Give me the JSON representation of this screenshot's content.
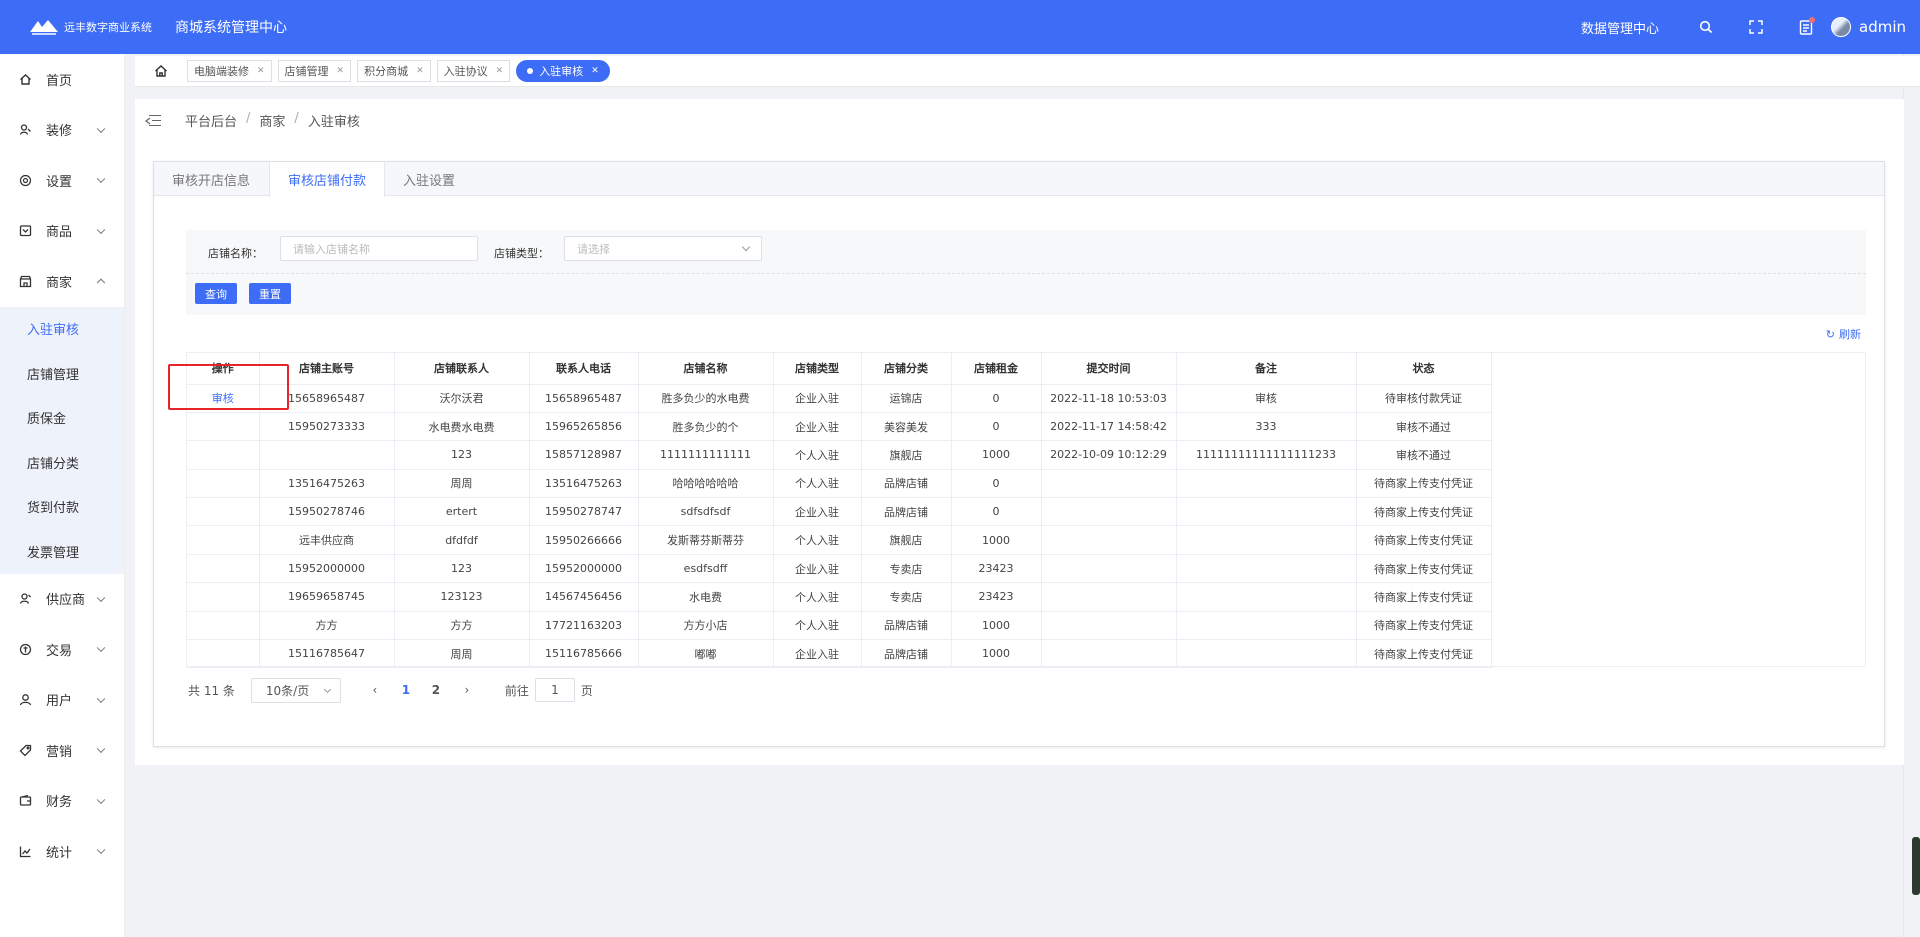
{
  "header": {
    "logo_text": "远丰数字商业系统",
    "system_title": "商城系统管理中心",
    "data_center": "数据管理中心",
    "username": "admin"
  },
  "sidebar": {
    "items": [
      {
        "label": "首页",
        "icon": "home-icon"
      },
      {
        "label": "装修",
        "icon": "brush-icon"
      },
      {
        "label": "设置",
        "icon": "gear-icon"
      },
      {
        "label": "商品",
        "icon": "goods-icon"
      },
      {
        "label": "商家",
        "icon": "store-icon"
      }
    ],
    "submenu": [
      "入驻审核",
      "店铺管理",
      "质保金",
      "店铺分类",
      "货到付款",
      "发票管理"
    ],
    "items_after": [
      {
        "label": "供应商",
        "icon": "supplier-icon"
      },
      {
        "label": "交易",
        "icon": "trade-icon"
      },
      {
        "label": "用户",
        "icon": "user-icon"
      },
      {
        "label": "营销",
        "icon": "tag-icon"
      },
      {
        "label": "财务",
        "icon": "wallet-icon"
      },
      {
        "label": "统计",
        "icon": "chart-icon"
      }
    ]
  },
  "page_tabs": [
    "电脑端装修",
    "店铺管理",
    "积分商城",
    "入驻协议",
    "入驻审核"
  ],
  "breadcrumb": [
    "平台后台",
    "商家",
    "入驻审核"
  ],
  "card_tabs": [
    "审核开店信息",
    "审核店铺付款",
    "入驻设置"
  ],
  "filter": {
    "shop_name_label": "店铺名称：",
    "shop_name_placeholder": "请输入店铺名称",
    "shop_type_label": "店铺类型：",
    "shop_type_placeholder": "请选择",
    "query_button": "查询",
    "reset_button": "重置"
  },
  "refresh_label": "刷新",
  "table": {
    "columns": [
      "操作",
      "店铺主账号",
      "店铺联系人",
      "联系人电话",
      "店铺名称",
      "店铺类型",
      "店铺分类",
      "店铺租金",
      "提交时间",
      "备注",
      "状态"
    ],
    "rows": [
      [
        "审核",
        "15658965487",
        "沃尔沃君",
        "15658965487",
        "胜多负少的水电费",
        "企业入驻",
        "运锦店",
        "0",
        "2022-11-18 10:53:03",
        "审核",
        "待审核付款凭证"
      ],
      [
        "",
        "15950273333",
        "水电费水电费",
        "15965265856",
        "胜多负少的个",
        "企业入驻",
        "美容美发",
        "0",
        "2022-11-17 14:58:42",
        "333",
        "审核不通过"
      ],
      [
        "",
        "",
        "123",
        "15857128987",
        "1111111111111",
        "个人入驻",
        "旗舰店",
        "1000",
        "2022-10-09 10:12:29",
        "11111111111111111233",
        "审核不通过"
      ],
      [
        "",
        "13516475263",
        "周周",
        "13516475263",
        "哈哈哈哈哈哈",
        "个人入驻",
        "品牌店铺",
        "0",
        "",
        "",
        "待商家上传支付凭证"
      ],
      [
        "",
        "15950278746",
        "ertert",
        "15950278747",
        "sdfsdfsdf",
        "企业入驻",
        "品牌店铺",
        "0",
        "",
        "",
        "待商家上传支付凭证"
      ],
      [
        "",
        "远丰供应商",
        "dfdfdf",
        "15950266666",
        "发斯蒂芬斯蒂芬",
        "个人入驻",
        "旗舰店",
        "1000",
        "",
        "",
        "待商家上传支付凭证"
      ],
      [
        "",
        "15952000000",
        "123",
        "15952000000",
        "esdfsdff",
        "企业入驻",
        "专卖店",
        "23423",
        "",
        "",
        "待商家上传支付凭证"
      ],
      [
        "",
        "19659658745",
        "123123",
        "14567456456",
        "水电费",
        "个人入驻",
        "专卖店",
        "23423",
        "",
        "",
        "待商家上传支付凭证"
      ],
      [
        "",
        "方方",
        "方方",
        "17721163203",
        "方方小店",
        "个人入驻",
        "品牌店铺",
        "1000",
        "",
        "",
        "待商家上传支付凭证"
      ],
      [
        "",
        "15116785647",
        "周周",
        "15116785666",
        "嘟嘟",
        "企业入驻",
        "品牌店铺",
        "1000",
        "",
        "",
        "待商家上传支付凭证"
      ]
    ]
  },
  "pagination": {
    "total": "共 11 条",
    "page_size": "10条/页",
    "pages": [
      "1",
      "2"
    ],
    "current": "1",
    "goto_prefix": "前往",
    "goto_value": "1",
    "goto_suffix": "页"
  },
  "colors": {
    "primary": "#3d6cf6",
    "highlight": "#e5252a"
  }
}
